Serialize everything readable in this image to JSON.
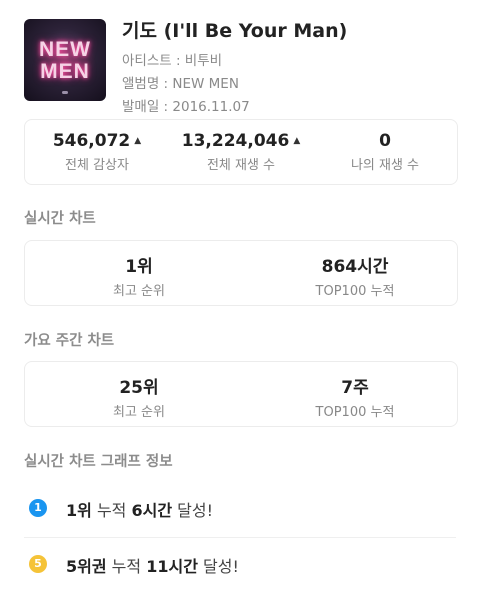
{
  "song": {
    "title": "기도 (I'll Be Your Man)",
    "artist": "아티스트 : 비투비",
    "album": "앨범명 : NEW MEN",
    "release": "발매일 : 2016.11.07",
    "art_text_line1": "NEW",
    "art_text_line2": "MEN"
  },
  "listen_stats": [
    {
      "value": "546,072",
      "label": "전체 감상자",
      "trend_icon": "triangle-up-icon"
    },
    {
      "value": "13,224,046",
      "label": "전체 재생 수",
      "trend_icon": "triangle-up-icon"
    },
    {
      "value": "0",
      "label": "나의 재생 수"
    }
  ],
  "realtime_chart": {
    "title": "실시간 차트",
    "stats": [
      {
        "value": "1위",
        "label": "최고 순위"
      },
      {
        "value": "864시간",
        "label": "TOP100 누적"
      }
    ]
  },
  "weekly_chart": {
    "title": "가요 주간 차트",
    "stats": [
      {
        "value": "25위",
        "label": "최고 순위"
      },
      {
        "value": "7주",
        "label": "TOP100 누적"
      }
    ]
  },
  "graph_info": {
    "title": "실시간 차트 그래프 정보",
    "items": [
      {
        "badge": "1",
        "badge_color": "#1a95f0",
        "rank": "1위",
        "mid": "누적",
        "hours": "6시간",
        "suffix": "달성!"
      },
      {
        "badge": "5",
        "badge_color": "#f5c338",
        "rank": "5위권",
        "mid": "누적",
        "hours": "11시간",
        "suffix": "달성!"
      }
    ]
  }
}
